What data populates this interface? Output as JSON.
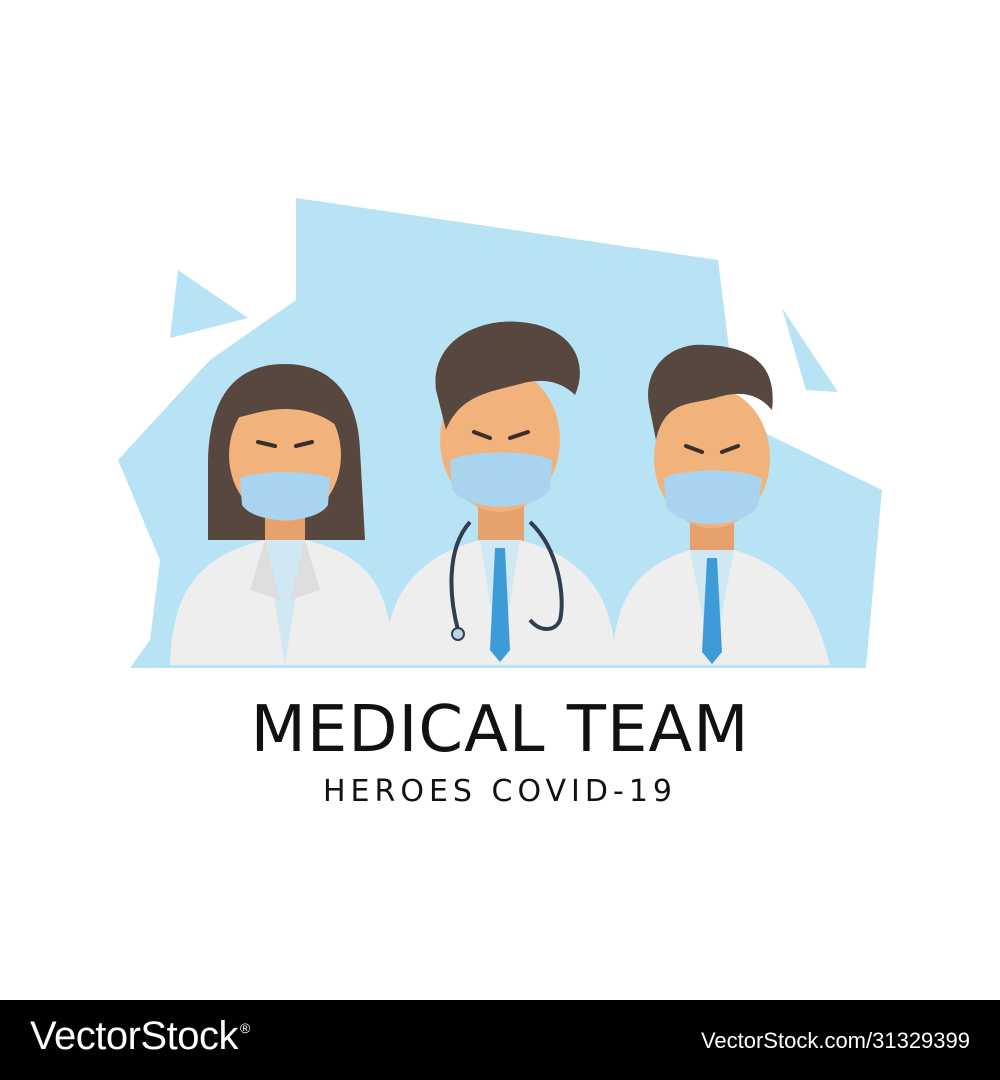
{
  "title": "MEDICAL TEAM",
  "subtitle": "HEROES COVID-19",
  "footer": {
    "logo_text": "VectorStock",
    "registered_mark": "®",
    "image_id": "VectorStock.com/31329399"
  },
  "colors": {
    "background_shape": "#b7e3f5",
    "mask": "#a9d4ef",
    "coat": "#eeeeee",
    "skin": "#f2b27c",
    "hair": "#57473f",
    "tie": "#3d9cd8",
    "footer_bg": "#000000"
  },
  "figures": [
    "female-doctor",
    "male-doctor-with-stethoscope",
    "male-doctor-curly-hair"
  ]
}
